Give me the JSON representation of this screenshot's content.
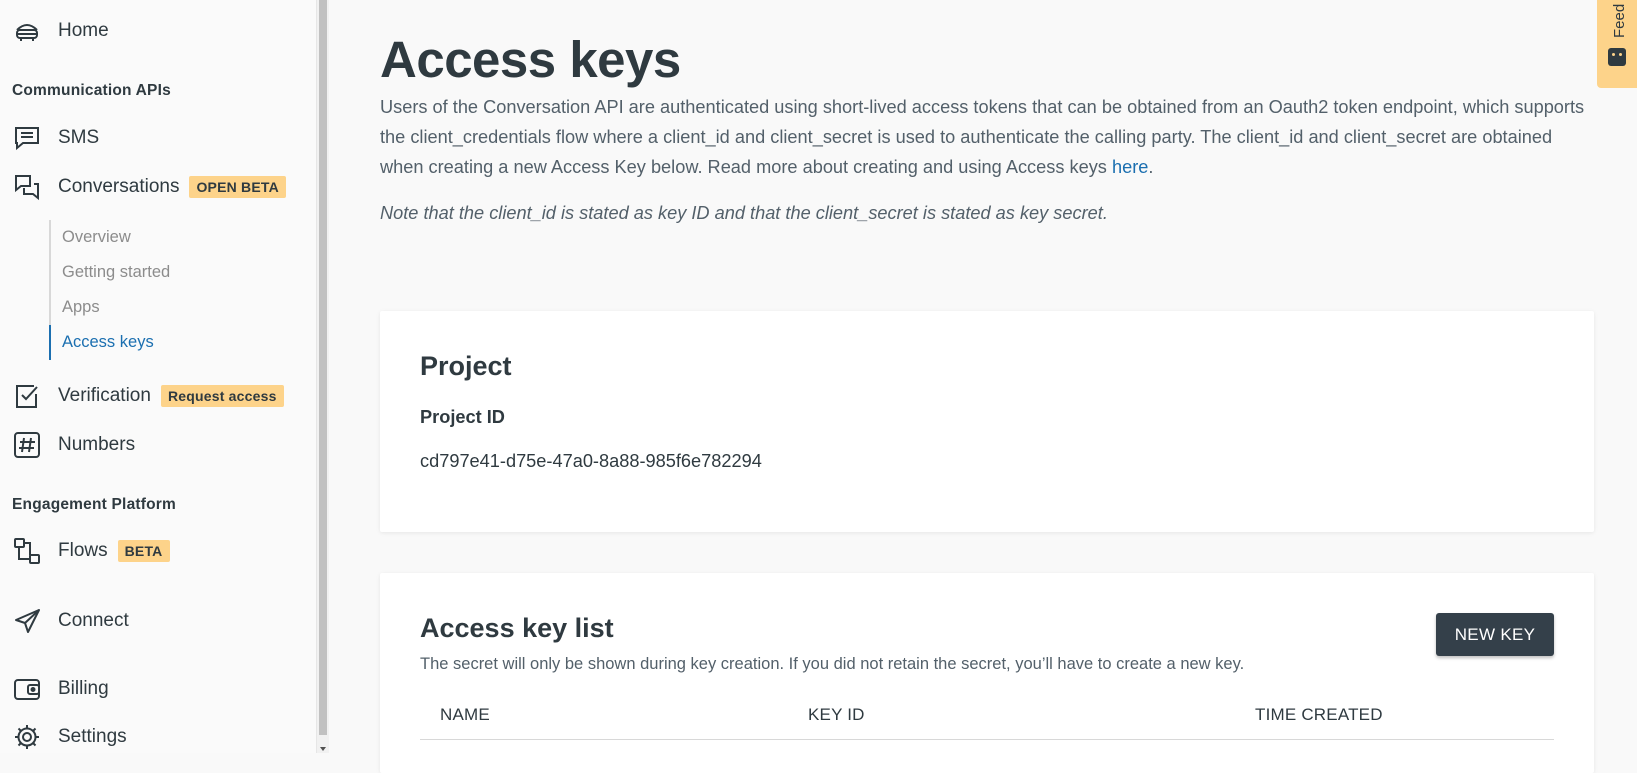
{
  "sidebar": {
    "home_label": "Home",
    "section_comm": "Communication APIs",
    "sms_label": "SMS",
    "conversations_label": "Conversations",
    "conversations_badge": "OPEN BETA",
    "sub_items": [
      {
        "label": "Overview"
      },
      {
        "label": "Getting started"
      },
      {
        "label": "Apps"
      },
      {
        "label": "Access keys"
      }
    ],
    "verification_label": "Verification",
    "verification_badge": "Request access",
    "numbers_label": "Numbers",
    "section_engagement": "Engagement Platform",
    "flows_label": "Flows",
    "flows_badge": "BETA",
    "connect_label": "Connect",
    "billing_label": "Billing",
    "settings_label": "Settings"
  },
  "main": {
    "title": "Access keys",
    "intro_text": "Users of the Conversation API are authenticated using short-lived access tokens that can be obtained from an Oauth2 token endpoint, which supports the client_credentials flow where a client_id and client_secret is used to authenticate the calling party. The client_id and client_secret are obtained when creating a new Access Key below. Read more about creating and using Access keys ",
    "intro_link": "here",
    "intro_end": ".",
    "note": "Note that the client_id is stated as key ID and that the client_secret is stated as key secret.",
    "project": {
      "heading": "Project",
      "id_label": "Project ID",
      "id_value": "cd797e41-d75e-47a0-8a88-985f6e782294"
    },
    "keys": {
      "heading": "Access key list",
      "description": "The secret will only be shown during key creation. If you did not retain the secret, you’ll have to create a new key.",
      "new_key_label": "NEW KEY",
      "columns": [
        "NAME",
        "KEY ID",
        "TIME CREATED"
      ]
    }
  },
  "feedback": {
    "label": "Feedback"
  },
  "colors": {
    "badge": "#fdd38a",
    "link": "#1b6fb0",
    "text": "#2f3a40",
    "button": "#34404a"
  }
}
